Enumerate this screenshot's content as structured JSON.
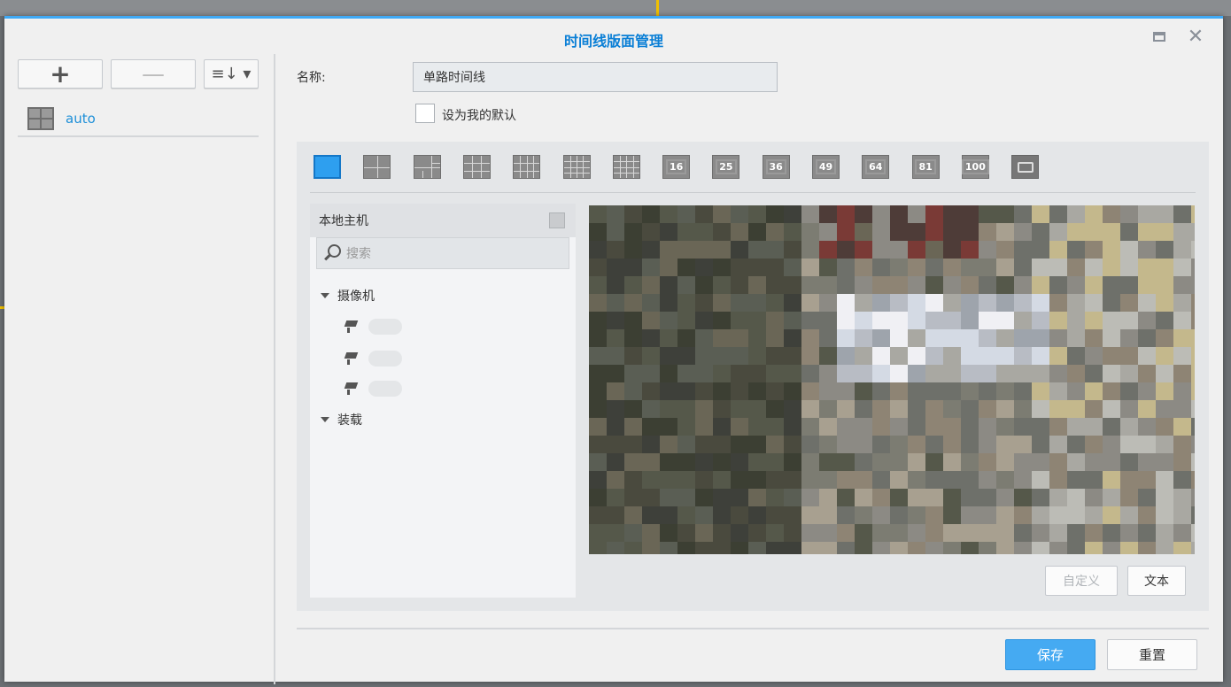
{
  "window": {
    "title": "时间线版面管理"
  },
  "toolbar": {
    "add_label": "+",
    "remove_label": "—",
    "sort_label": "≡↓ ▾"
  },
  "layouts_list": [
    {
      "label": "auto"
    }
  ],
  "form": {
    "name_label": "名称:",
    "name_value": "单路时间线",
    "default_checkbox_label": "设为我的默认",
    "default_checked": false
  },
  "layout_options": [
    {
      "label": "",
      "grid": "1x1",
      "selected": true
    },
    {
      "label": "",
      "grid": "2x2"
    },
    {
      "label": "",
      "grid": "1+5"
    },
    {
      "label": "",
      "grid": "3x3"
    },
    {
      "label": "",
      "grid": "1+12"
    },
    {
      "label": "",
      "grid": "4x4-center"
    },
    {
      "label": "",
      "grid": "4x4"
    },
    {
      "label": "16"
    },
    {
      "label": "25"
    },
    {
      "label": "36"
    },
    {
      "label": "49"
    },
    {
      "label": "64"
    },
    {
      "label": "81"
    },
    {
      "label": "100"
    },
    {
      "label": "",
      "icon": "video-camera-icon"
    }
  ],
  "camera_tree": {
    "host_label": "本地主机",
    "search_placeholder": "搜索",
    "groups": [
      {
        "label": "摄像机",
        "items": 3
      },
      {
        "label": "装载"
      }
    ]
  },
  "preview_buttons": {
    "custom_label": "自定义",
    "text_label": "文本"
  },
  "footer": {
    "save_label": "保存",
    "reset_label": "重置"
  },
  "colors": {
    "accent": "#2e9fef",
    "title": "#0a7fd6",
    "save_button": "#45aaf2"
  }
}
